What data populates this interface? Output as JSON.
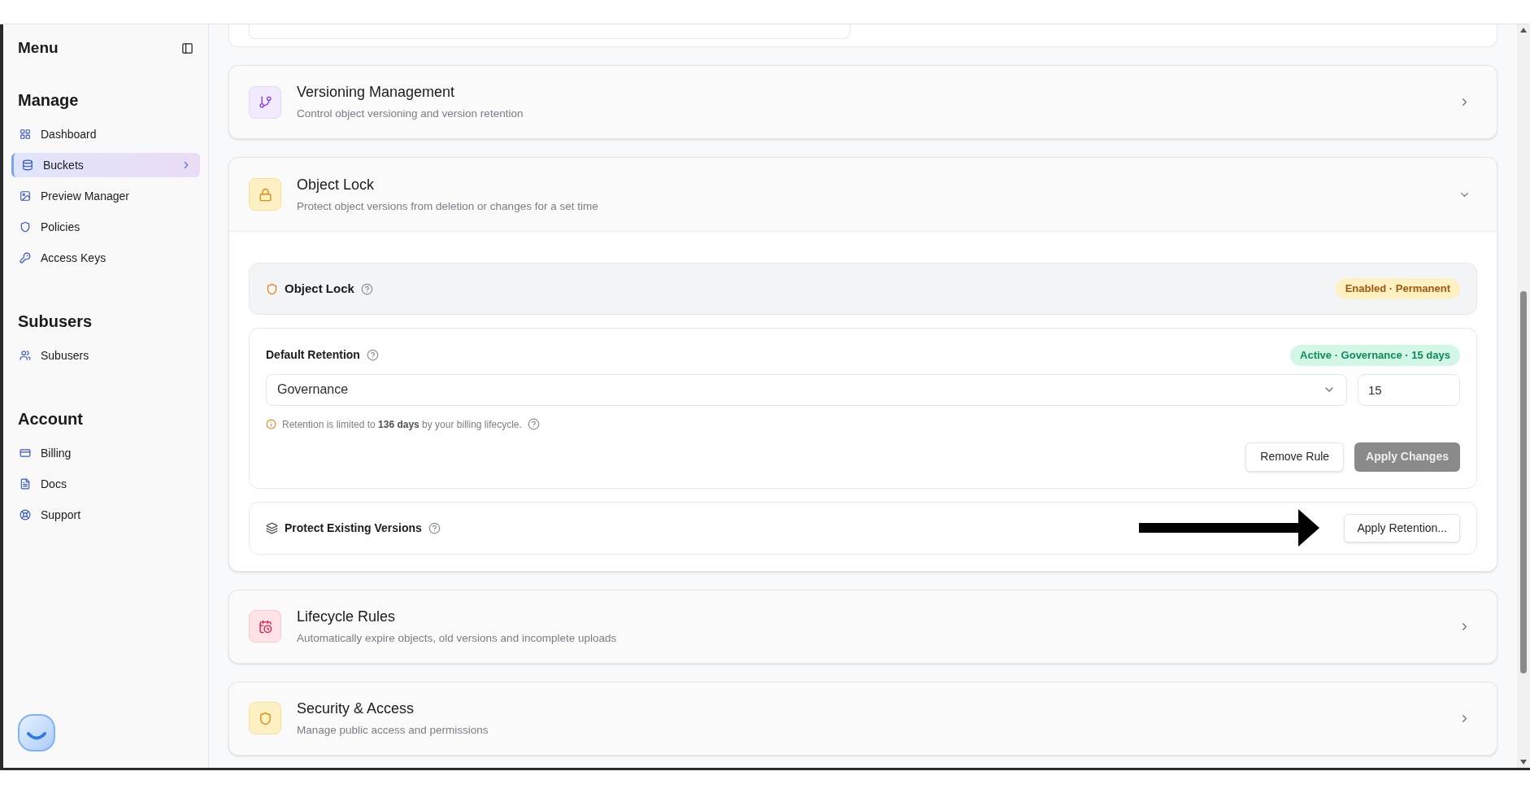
{
  "sidebar": {
    "title": "Menu",
    "sections": [
      {
        "heading": "Manage",
        "items": [
          {
            "label": "Dashboard",
            "selected": false
          },
          {
            "label": "Buckets",
            "selected": true
          },
          {
            "label": "Preview Manager",
            "selected": false
          },
          {
            "label": "Policies",
            "selected": false
          },
          {
            "label": "Access Keys",
            "selected": false
          }
        ]
      },
      {
        "heading": "Subusers",
        "items": [
          {
            "label": "Subusers",
            "selected": false
          }
        ]
      },
      {
        "heading": "Account",
        "items": [
          {
            "label": "Billing",
            "selected": false
          },
          {
            "label": "Docs",
            "selected": false
          },
          {
            "label": "Support",
            "selected": false
          }
        ]
      }
    ]
  },
  "sections": [
    {
      "title": "Versioning Management",
      "subtitle": "Control object versioning and version retention",
      "expanded": false
    },
    {
      "title": "Object Lock",
      "subtitle": "Protect object versions from deletion or changes for a set time",
      "expanded": true
    },
    {
      "title": "Lifecycle Rules",
      "subtitle": "Automatically expire objects, old versions and incomplete uploads",
      "expanded": false
    },
    {
      "title": "Security & Access",
      "subtitle": "Manage public access and permissions",
      "expanded": false
    }
  ],
  "object_lock": {
    "status": {
      "title": "Object Lock",
      "badge": "Enabled · Permanent"
    },
    "default_retention": {
      "title": "Default Retention",
      "badge": "Active · Governance · 15 days",
      "mode": "Governance",
      "days": "15",
      "hint": "Retention is limited to **136 days** by your billing lifecycle.",
      "buttons": [
        {
          "label": "Remove Rule",
          "disabled": false
        },
        {
          "label": "Apply Changes",
          "disabled": true
        }
      ]
    },
    "protect": {
      "title": "Protect Existing Versions",
      "button": "Apply Retention..."
    }
  }
}
